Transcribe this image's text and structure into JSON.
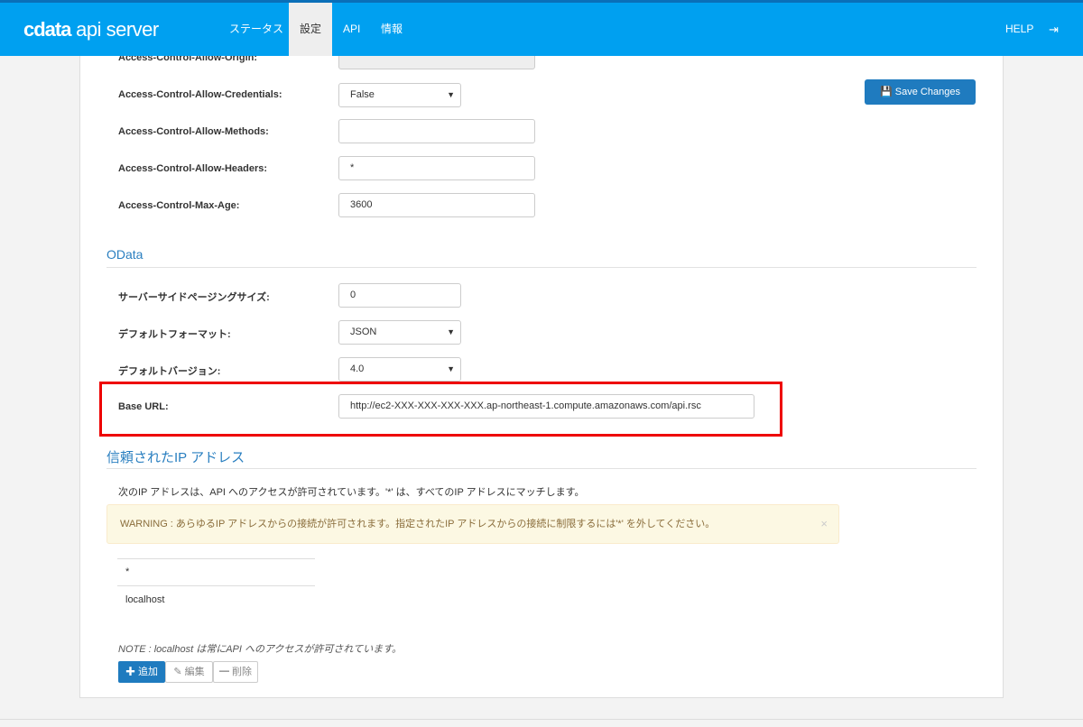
{
  "nav": {
    "logo_brand": "cdata",
    "logo_product": "api server",
    "items": [
      "ステータス",
      "設定",
      "API",
      "情報"
    ],
    "help": "HELP"
  },
  "cors": {
    "origin_label": "Access-Control-Allow-Origin:",
    "credentials_label": "Access-Control-Allow-Credentials:",
    "credentials_value": "False",
    "methods_label": "Access-Control-Allow-Methods:",
    "methods_value": "",
    "headers_label": "Access-Control-Allow-Headers:",
    "headers_value": "*",
    "maxage_label": "Access-Control-Max-Age:",
    "maxage_value": "3600"
  },
  "save_label": "Save Changes",
  "odata": {
    "title": "OData",
    "paging_label": "サーバーサイドページングサイズ:",
    "paging_value": "0",
    "format_label": "デフォルトフォーマット:",
    "format_value": "JSON",
    "version_label": "デフォルトバージョン:",
    "version_value": "4.0",
    "baseurl_label": "Base URL:",
    "baseurl_value": "http://ec2-XXX-XXX-XXX-XXX.ap-northeast-1.compute.amazonaws.com/api.rsc"
  },
  "ip": {
    "title": "信頼されたIP アドレス",
    "desc": "次のIP アドレスは、API へのアクセスが許可されています。'*' は、すべてのIP アドレスにマッチします。",
    "warning": "WARNING : あらゆるIP アドレスからの接続が許可されます。指定されたIP アドレスからの接続に制限するには'*' を外してください。",
    "list": [
      "*",
      "localhost"
    ],
    "note": "NOTE : localhost は常にAPI へのアクセスが許可されています。",
    "add": "追加",
    "edit": "編集",
    "delete": "削除"
  }
}
